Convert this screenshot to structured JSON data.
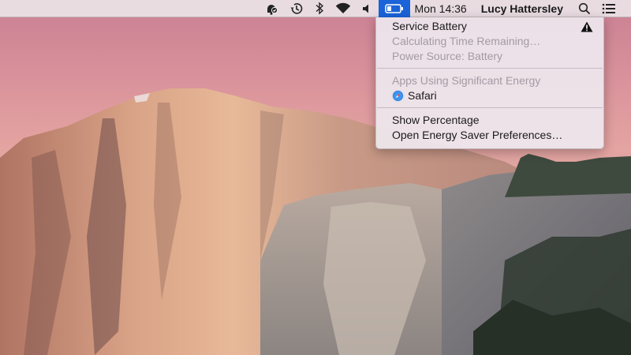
{
  "menubar": {
    "icons": [
      "notifications-icon",
      "time-machine-icon",
      "bluetooth-icon",
      "wifi-icon",
      "volume-icon",
      "battery-icon"
    ],
    "clock": "Mon 14:36",
    "user": "Lucy Hattersley",
    "spotlight_icon": "search-icon",
    "notification_center_icon": "list-icon",
    "accent_color": "#1a63d8"
  },
  "battery_menu": {
    "status_title": "Service Battery",
    "status_warning_icon": "warning-icon",
    "time_remaining": "Calculating Time Remaining…",
    "power_source": "Power Source: Battery",
    "apps_header": "Apps Using Significant Energy",
    "apps": [
      {
        "name": "Safari",
        "icon": "safari-icon"
      }
    ],
    "show_percentage": "Show Percentage",
    "open_prefs": "Open Energy Saver Preferences…"
  }
}
